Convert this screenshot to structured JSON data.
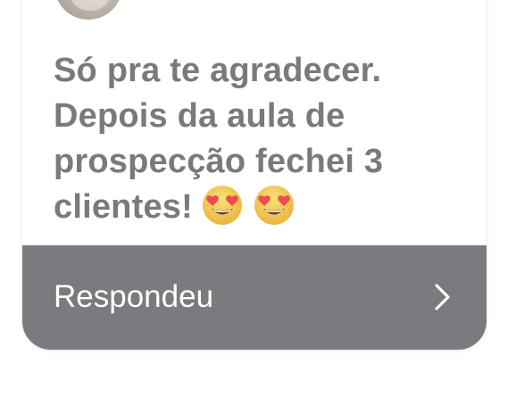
{
  "message": {
    "text": "Só pra te agradecer. Depois da aula de prospecção fechei 3 clientes!",
    "emojis": [
      "heart-eyes-emoji",
      "heart-eyes-emoji"
    ]
  },
  "footer": {
    "reply_label": "Respondeu",
    "chevron_icon": "chevron-right-icon"
  },
  "colors": {
    "text_gray": "#7a7a7c",
    "footer_bg": "#7b7b7f",
    "emoji_face": "#f6cf5b",
    "heart": "#ee4b52"
  }
}
